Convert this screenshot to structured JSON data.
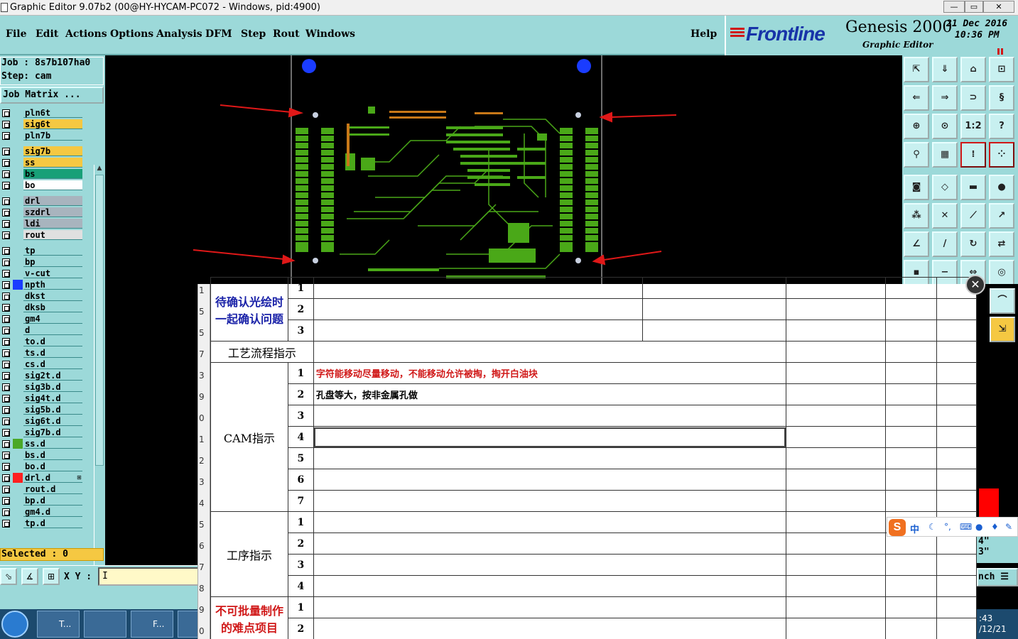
{
  "window": {
    "title": "Graphic Editor 9.07b2 (00@HY-HYCAM-PC072 - Windows, pid:4900)",
    "min": "—",
    "max": "▭",
    "close": "✕"
  },
  "menu": {
    "items": [
      "File",
      "Edit",
      "Actions",
      "Options",
      "Analysis",
      "DFM",
      "Step",
      "Rout",
      "Windows"
    ],
    "help": "Help"
  },
  "brand": {
    "logo": "Frontline",
    "product": "Genesis 2000",
    "subtitle": "Graphic Editor",
    "date": "21 Dec 2016",
    "time": "10:36 PM",
    "accent": "#d01818"
  },
  "job": {
    "job_line": "Job : 8s7b107ha0",
    "step_line": "Step: cam",
    "matrix_button": "Job Matrix ..."
  },
  "layers": [
    {
      "name": "pln6t",
      "color": "#9cd9d9"
    },
    {
      "name": "sig6t",
      "color": "#f5c842"
    },
    {
      "name": "pln7b",
      "color": "#9cd9d9"
    },
    {
      "name": "sig7b",
      "color": "#f5c842"
    },
    {
      "name": "ss",
      "color": "#f5c842"
    },
    {
      "name": "bs",
      "color": "#18a078"
    },
    {
      "name": "bo",
      "color": "#ffffff"
    },
    {
      "name": "drl",
      "color": "#a8b4be"
    },
    {
      "name": "szdrl",
      "color": "#a8b4be"
    },
    {
      "name": "ldi",
      "color": "#a8b4be"
    },
    {
      "name": "rout",
      "color": "#e0e0e0"
    },
    {
      "name": "tp",
      "color": "#9cd9d9"
    },
    {
      "name": "bp",
      "color": "#9cd9d9"
    },
    {
      "name": "v-cut",
      "color": "#9cd9d9"
    },
    {
      "name": "npth",
      "color": "#9cd9d9",
      "swatch": "#1a3cff"
    },
    {
      "name": "dkst",
      "color": "#9cd9d9"
    },
    {
      "name": "dksb",
      "color": "#9cd9d9"
    },
    {
      "name": "gm4",
      "color": "#9cd9d9"
    },
    {
      "name": "d",
      "color": "#9cd9d9"
    },
    {
      "name": "to.d",
      "color": "#9cd9d9"
    },
    {
      "name": "ts.d",
      "color": "#9cd9d9"
    },
    {
      "name": "cs.d",
      "color": "#9cd9d9"
    },
    {
      "name": "sig2t.d",
      "color": "#9cd9d9"
    },
    {
      "name": "sig3b.d",
      "color": "#9cd9d9"
    },
    {
      "name": "sig4t.d",
      "color": "#9cd9d9"
    },
    {
      "name": "sig5b.d",
      "color": "#9cd9d9"
    },
    {
      "name": "sig6t.d",
      "color": "#9cd9d9"
    },
    {
      "name": "sig7b.d",
      "color": "#9cd9d9"
    },
    {
      "name": "ss.d",
      "color": "#9cd9d9",
      "swatch": "#4aa828"
    },
    {
      "name": "bs.d",
      "color": "#9cd9d9"
    },
    {
      "name": "bo.d",
      "color": "#9cd9d9"
    },
    {
      "name": "drl.d",
      "color": "#9cd9d9",
      "swatch": "#ff2020",
      "mark": "⊞"
    },
    {
      "name": "rout.d",
      "color": "#9cd9d9"
    },
    {
      "name": "bp.d",
      "color": "#9cd9d9"
    },
    {
      "name": "gm4.d",
      "color": "#9cd9d9"
    },
    {
      "name": "tp.d",
      "color": "#9cd9d9"
    }
  ],
  "selected": "Selected : 0",
  "xy": {
    "label": "X Y :",
    "value": "I"
  },
  "units": {
    "line1": "4\"",
    "line2": "3\"",
    "button": "nch"
  },
  "sheet": {
    "row_numbers": [
      "1",
      "5",
      "5",
      "7",
      "3",
      "9",
      "0",
      "1",
      "2",
      "3",
      "4",
      "5",
      "6",
      "7",
      "8",
      "9",
      "0"
    ],
    "sec1": {
      "label": "待确认光绘时一起确认问题",
      "nums": [
        "1",
        "2",
        "3"
      ]
    },
    "sec2": {
      "label": "工艺流程指示"
    },
    "sec3": {
      "label": "CAM指示",
      "nums": [
        "1",
        "2",
        "3",
        "4",
        "5",
        "6",
        "7"
      ],
      "line1": "字符能移动尽量移动，不能移动允许被掏，掏开白油块",
      "line2": "孔盘等大，按非金属孔做"
    },
    "sec4": {
      "label": "工序指示",
      "nums": [
        "1",
        "2",
        "3",
        "4"
      ]
    },
    "sec5": {
      "label": "不可批量制作的难点项目",
      "nums": [
        "1",
        "2"
      ]
    }
  },
  "ime": {
    "logo": "S",
    "mode": "中"
  },
  "taskbar": {
    "items": [
      "T...",
      "",
      "F...",
      ""
    ],
    "clock_time": ":43",
    "clock_date": "/12/21"
  },
  "canvas": {
    "board_color": "#4aa818",
    "fiducial_color": "#1a3cff",
    "arrow_color": "#e01818"
  }
}
